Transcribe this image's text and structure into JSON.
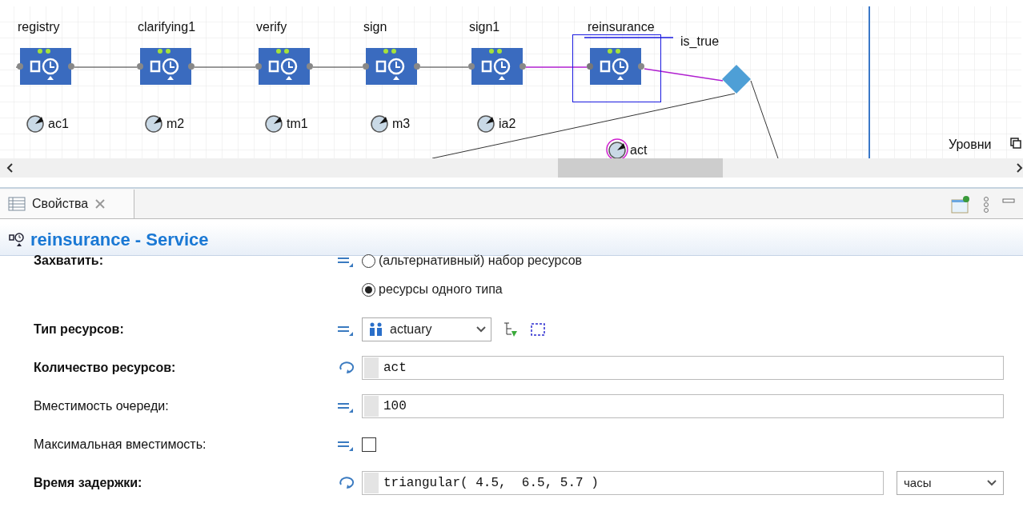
{
  "canvas": {
    "blocks": [
      {
        "label": "registry",
        "selected": false
      },
      {
        "label": "clarifying1",
        "selected": false
      },
      {
        "label": "verify",
        "selected": false
      },
      {
        "label": "sign",
        "selected": false
      },
      {
        "label": "sign1",
        "selected": false
      },
      {
        "label": "reinsurance",
        "selected": true
      }
    ],
    "resources": [
      {
        "label": "ac1",
        "selected": false
      },
      {
        "label": "m2",
        "selected": false
      },
      {
        "label": "tm1",
        "selected": false
      },
      {
        "label": "m3",
        "selected": false
      },
      {
        "label": "ia2",
        "selected": false
      },
      {
        "label": "act",
        "selected": true
      }
    ],
    "decision_label": "is_true",
    "levels_label": "Уровни"
  },
  "panel": {
    "tab": {
      "label": "Свойства"
    },
    "title": "reinsurance - Service",
    "properties": [
      {
        "kind": "radio",
        "label": "Захватить:",
        "bold": true,
        "dynamic": false,
        "options": [
          {
            "label": "(альтернативный) набор ресурсов",
            "selected": false
          },
          {
            "label": "ресурсы одного типа",
            "selected": true
          }
        ]
      },
      {
        "kind": "dropdown",
        "label": "Тип ресурсов:",
        "bold": true,
        "dynamic": false,
        "value": "actuary"
      },
      {
        "kind": "text",
        "label": "Количество ресурсов:",
        "bold": true,
        "dynamic": true,
        "value": "act"
      },
      {
        "kind": "text",
        "label": "Вместимость очереди:",
        "bold": false,
        "dynamic": false,
        "value": "100"
      },
      {
        "kind": "checkbox",
        "label": "Максимальная вместимость:",
        "bold": false,
        "dynamic": false,
        "checked": false
      },
      {
        "kind": "text_unit",
        "label": "Время задержки:",
        "bold": true,
        "dynamic": true,
        "value": "triangular( 4.5,  6.5, 5.7 )",
        "unit": "часы"
      }
    ]
  }
}
